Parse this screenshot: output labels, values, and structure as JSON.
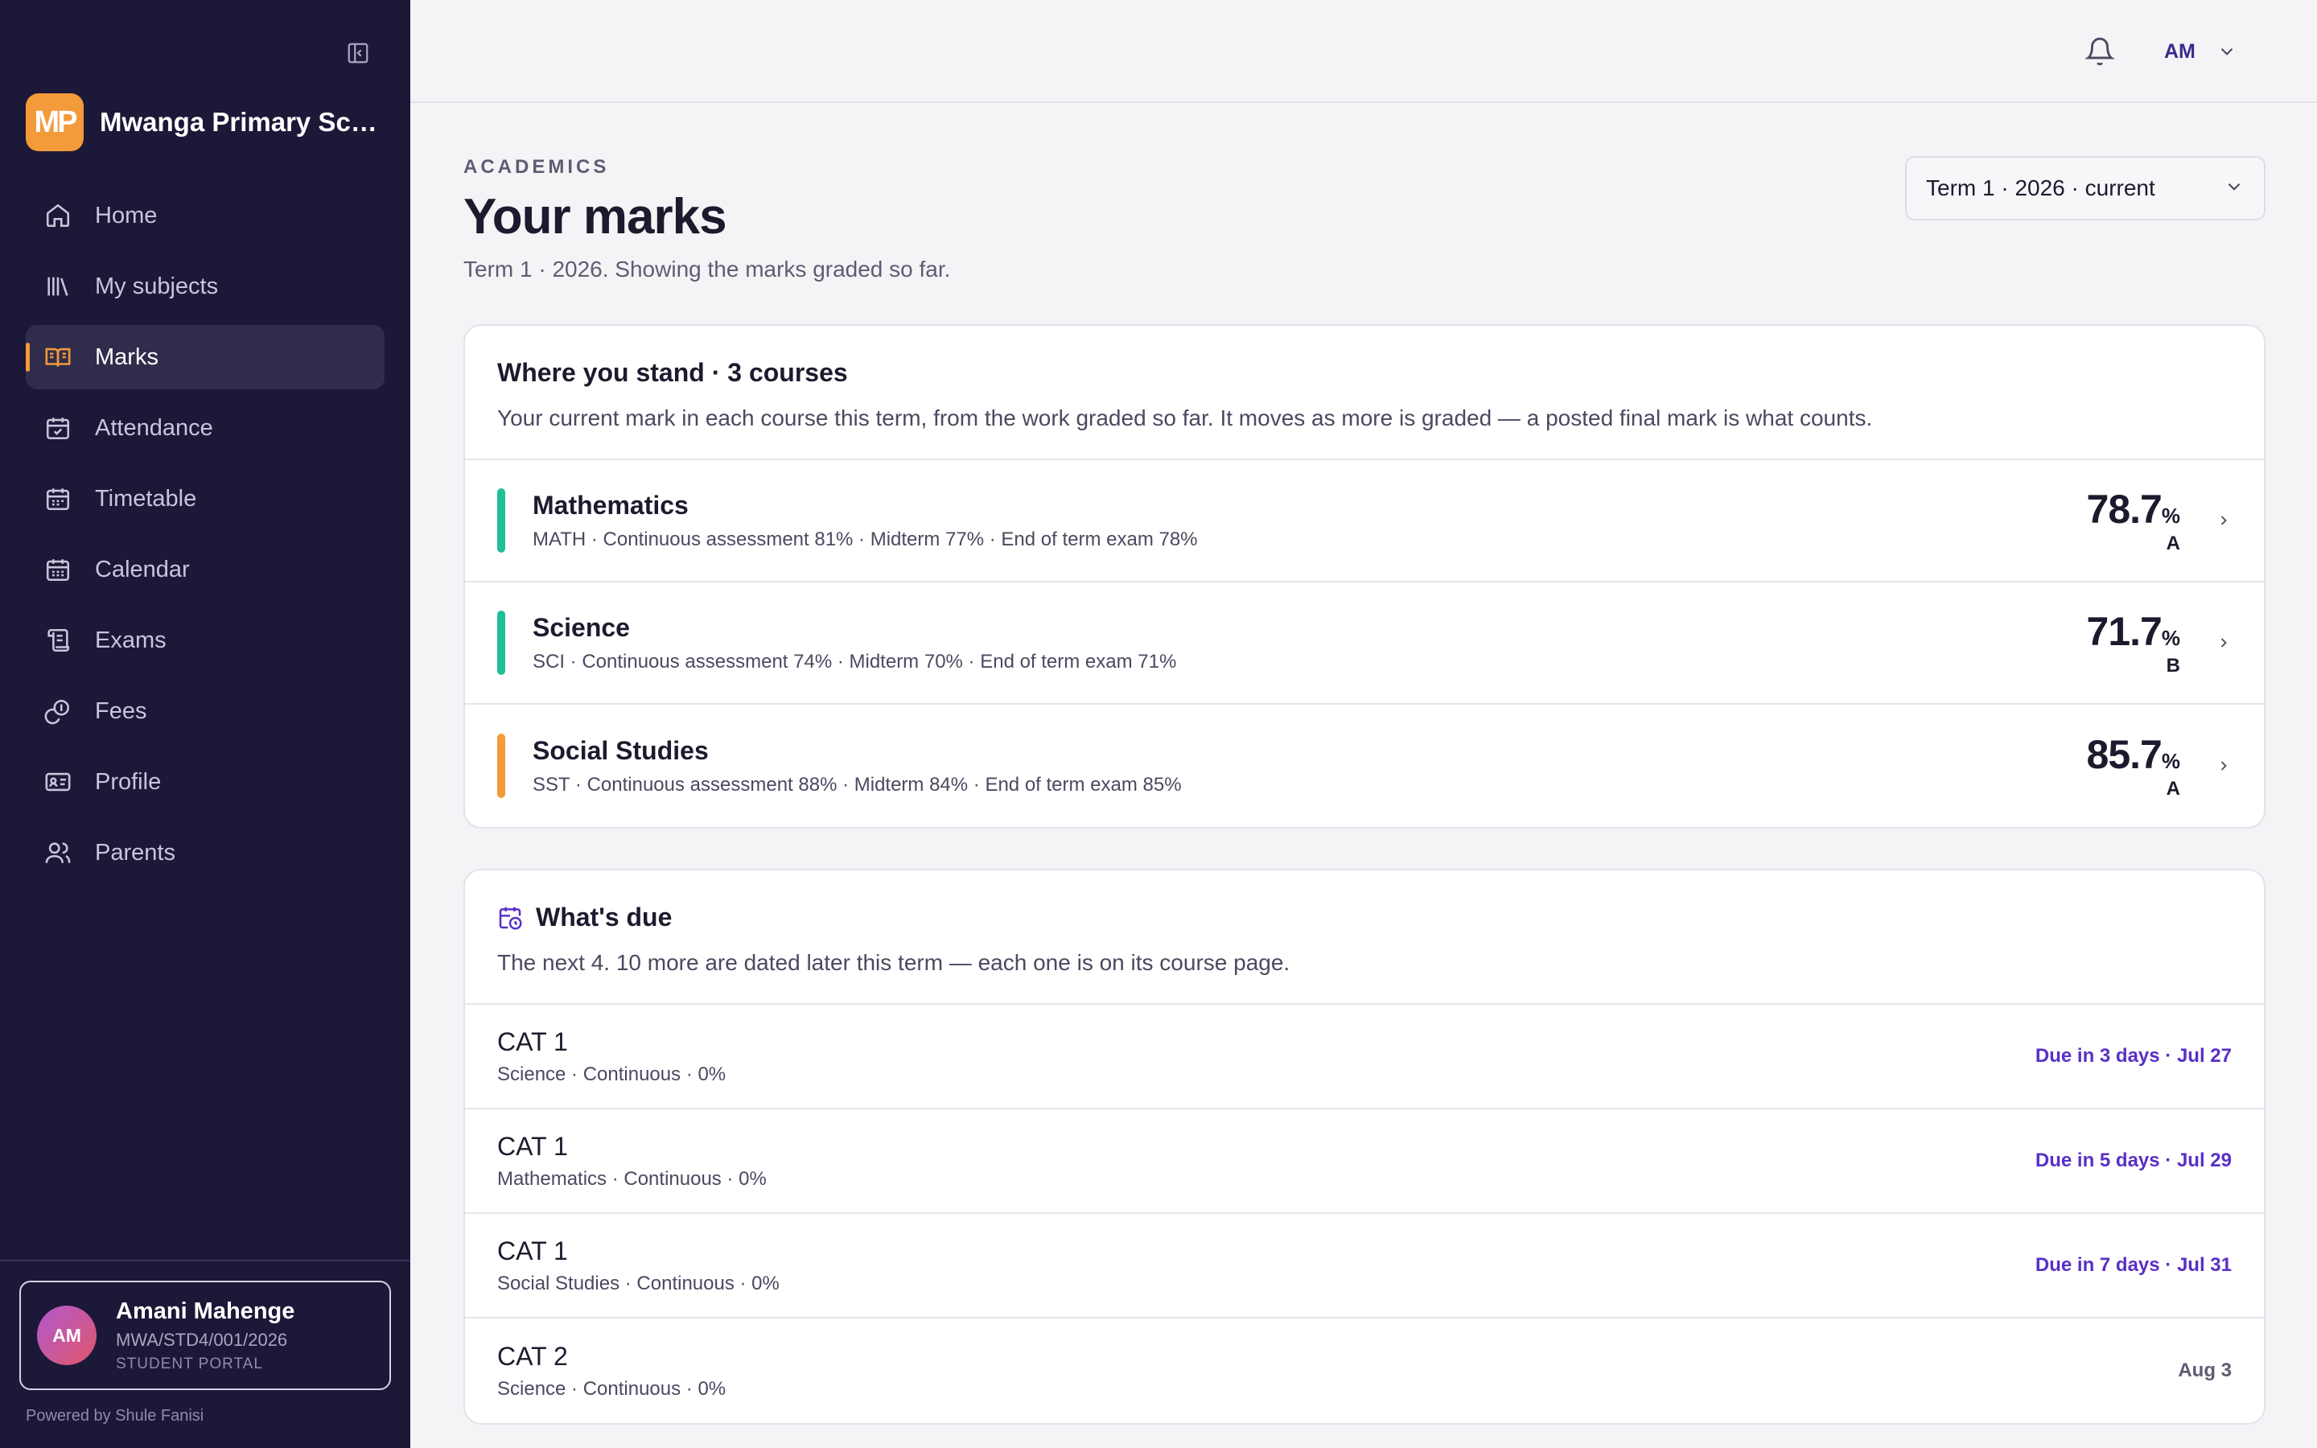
{
  "sidebar": {
    "brand_initials": "MP",
    "brand_name": "Mwanga Primary School",
    "items": [
      {
        "label": "Home",
        "icon": "home-icon"
      },
      {
        "label": "My subjects",
        "icon": "library-icon"
      },
      {
        "label": "Marks",
        "icon": "book-open-icon",
        "active": true
      },
      {
        "label": "Attendance",
        "icon": "calendar-check-icon"
      },
      {
        "label": "Timetable",
        "icon": "calendar-grid-icon"
      },
      {
        "label": "Calendar",
        "icon": "calendar-icon"
      },
      {
        "label": "Exams",
        "icon": "scroll-icon"
      },
      {
        "label": "Fees",
        "icon": "coins-icon"
      },
      {
        "label": "Profile",
        "icon": "id-card-icon"
      },
      {
        "label": "Parents",
        "icon": "users-icon"
      }
    ],
    "user": {
      "initials": "AM",
      "name": "Amani Mahenge",
      "id": "MWA/STD4/001/2026",
      "role": "STUDENT PORTAL"
    },
    "powered_by": "Powered by Shule Fanisi"
  },
  "topbar": {
    "user_initials": "AM"
  },
  "page": {
    "eyebrow": "ACADEMICS",
    "title": "Your marks",
    "subtitle": "Term 1 · 2026. Showing the marks graded so far.",
    "term_select": "Term 1 · 2026 · current"
  },
  "standing": {
    "title": "Where you stand · 3 courses",
    "description": "Your current mark in each course this term, from the work graded so far. It moves as more is graded — a posted final mark is what counts.",
    "courses": [
      {
        "name": "Mathematics",
        "detail": "MATH · Continuous assessment 81% · Midterm 77% · End of term exam 78%",
        "score": "78.7",
        "pct": "%",
        "grade": "A",
        "color": "#1fbf98"
      },
      {
        "name": "Science",
        "detail": "SCI · Continuous assessment 74% · Midterm 70% · End of term exam 71%",
        "score": "71.7",
        "pct": "%",
        "grade": "B",
        "color": "#1fbf98"
      },
      {
        "name": "Social Studies",
        "detail": "SST · Continuous assessment 88% · Midterm 84% · End of term exam 85%",
        "score": "85.7",
        "pct": "%",
        "grade": "A",
        "color": "#f39a3a"
      }
    ]
  },
  "due": {
    "title": "What's due",
    "description": "The next 4. 10 more are dated later this term — each one is on its course page.",
    "items": [
      {
        "name": "CAT 1",
        "meta": "Science · Continuous · 0%",
        "date": "Due in 3 days · Jul 27"
      },
      {
        "name": "CAT 1",
        "meta": "Mathematics · Continuous · 0%",
        "date": "Due in 5 days · Jul 29"
      },
      {
        "name": "CAT 1",
        "meta": "Social Studies · Continuous · 0%",
        "date": "Due in 7 days · Jul 31"
      },
      {
        "name": "CAT 2",
        "meta": "Science · Continuous · 0%",
        "date": "Aug 3"
      }
    ]
  }
}
